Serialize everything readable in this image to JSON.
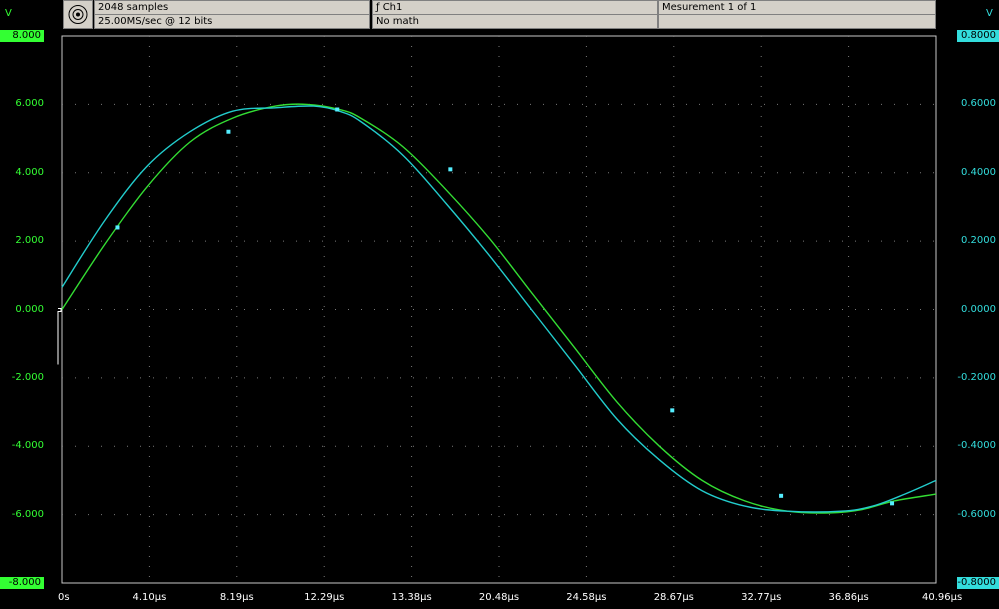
{
  "header": {
    "samples": "2048 samples",
    "rate": "25.00MS/sec @ 12 bits",
    "channel": "ƒ Ch1",
    "math": "No math",
    "measurement": "Mesurement 1 of 1",
    "empty_cell": ""
  },
  "colors": {
    "left_axis": "#33ff33",
    "right_axis": "#33dddd",
    "trace_green": "#33dd33",
    "trace_cyan": "#22cccc",
    "grid": "#7a7a7a",
    "header_bg": "#d4d0c8"
  },
  "icons": {
    "header_icon": "target-icon"
  },
  "chart_data": {
    "type": "line",
    "left_unit": "V",
    "right_unit": "V",
    "left_ylim": [
      -8,
      8
    ],
    "right_ylim": [
      -0.8,
      0.8
    ],
    "left_ticks": [
      "8.000",
      "6.000",
      "4.000",
      "2.000",
      "0.000",
      "-2.000",
      "-4.000",
      "-6.000",
      "-8.000"
    ],
    "right_ticks": [
      "0.8000",
      "0.6000",
      "0.4000",
      "0.2000",
      "0.0000",
      "-0.2000",
      "-0.4000",
      "-0.6000",
      "-0.8000"
    ],
    "x_ticks": [
      "0s",
      "4.10µs",
      "8.19µs",
      "12.29µs",
      "13.38µs",
      "20.48µs",
      "24.58µs",
      "28.67µs",
      "32.77µs",
      "36.86µs",
      "40.96µs"
    ],
    "x_range_us": [
      0,
      40.96
    ],
    "grid": true,
    "series": [
      {
        "color": "green",
        "axis": "left",
        "x_us": [
          0,
          2,
          4,
          6,
          8,
          10,
          11.5,
          13,
          14,
          16,
          18,
          20,
          22,
          24,
          26,
          28,
          30,
          32,
          34,
          36,
          37.5,
          39,
          40.96
        ],
        "y": [
          0.0,
          1.9,
          3.6,
          4.9,
          5.6,
          5.95,
          6.0,
          5.85,
          5.6,
          4.75,
          3.5,
          2.1,
          0.5,
          -1.1,
          -2.7,
          -4.0,
          -5.0,
          -5.6,
          -5.9,
          -5.95,
          -5.85,
          -5.6,
          -5.4
        ]
      },
      {
        "color": "cyan",
        "axis": "right",
        "x_us": [
          0,
          2,
          4,
          6,
          8,
          10,
          11.8,
          13,
          14,
          16,
          18,
          20,
          22,
          24,
          26,
          28,
          30,
          32,
          34,
          36.5,
          38,
          39.5,
          40.96
        ],
        "y": [
          0.065,
          0.26,
          0.42,
          0.52,
          0.58,
          0.59,
          0.595,
          0.58,
          0.55,
          0.45,
          0.31,
          0.16,
          0.0,
          -0.16,
          -0.32,
          -0.44,
          -0.53,
          -0.575,
          -0.59,
          -0.59,
          -0.575,
          -0.54,
          -0.5
        ]
      }
    ],
    "markers": [
      {
        "x_us": 2.6,
        "y": 0.24
      },
      {
        "x_us": 7.8,
        "y": 0.52
      },
      {
        "x_us": 12.9,
        "y": 0.585
      },
      {
        "x_us": 18.2,
        "y": 0.41
      },
      {
        "x_us": 28.6,
        "y": -0.295
      },
      {
        "x_us": 33.7,
        "y": -0.545
      },
      {
        "x_us": 38.9,
        "y": -0.567
      }
    ]
  }
}
